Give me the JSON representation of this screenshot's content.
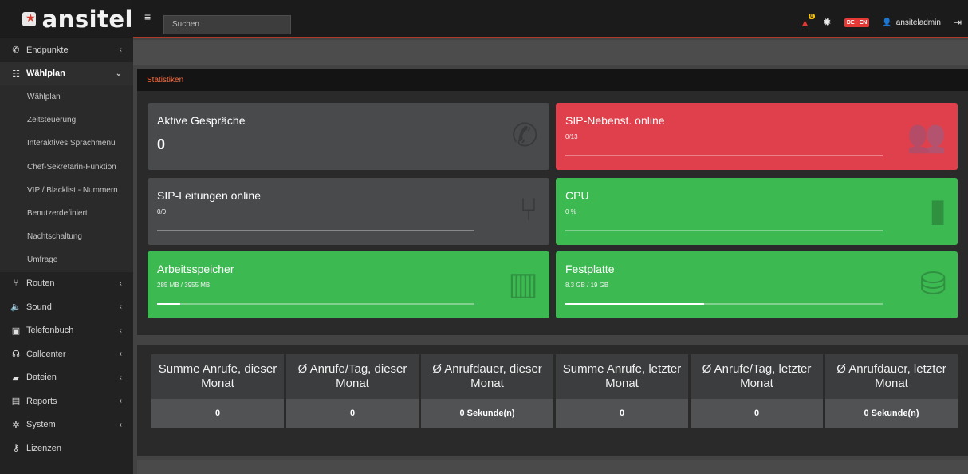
{
  "brand": {
    "name": "ansitel"
  },
  "header": {
    "search_placeholder": "Suchen",
    "alert_count": "0",
    "lang_de": "DE",
    "lang_en": "EN",
    "user": "ansiteladmin"
  },
  "sidebar": {
    "items": [
      {
        "label": "Endpunkte",
        "icon": "phone-icon"
      },
      {
        "label": "Wählplan",
        "icon": "sitemap-icon"
      },
      {
        "label": "Routen",
        "icon": "route-icon"
      },
      {
        "label": "Sound",
        "icon": "speaker-icon"
      },
      {
        "label": "Telefonbuch",
        "icon": "book-icon"
      },
      {
        "label": "Callcenter",
        "icon": "headset-icon"
      },
      {
        "label": "Dateien",
        "icon": "folder-icon"
      },
      {
        "label": "Reports",
        "icon": "chart-icon"
      },
      {
        "label": "System",
        "icon": "cogs-icon"
      },
      {
        "label": "Lizenzen",
        "icon": "key-icon"
      }
    ],
    "subitems": [
      "Wählplan",
      "Zeitsteuerung",
      "Interaktives Sprachmenü",
      "Chef-Sekretärin-Funktion",
      "VIP / Blacklist - Nummern",
      "Benutzerdefiniert",
      "Nachtschaltung",
      "Umfrage"
    ]
  },
  "stats": {
    "heading": "Statistiken",
    "cards": [
      {
        "title": "Aktive Gespräche",
        "value": "0",
        "color": "#484a4c"
      },
      {
        "title": "SIP-Nebenst. online",
        "value": "0/13",
        "color": "#e0404b",
        "progress": 0
      },
      {
        "title": "SIP-Leitungen online",
        "value": "0/0",
        "color": "#484a4c",
        "progress": 0
      },
      {
        "title": "CPU",
        "value": "0 %",
        "color": "#3db952",
        "progress": 0
      },
      {
        "title": "Arbeitsspeicher",
        "value": "285 MB / 3955 MB",
        "color": "#3db952",
        "progress": 0.072
      },
      {
        "title": "Festplatte",
        "value": "8.3 GB / 19 GB",
        "color": "#3db952",
        "progress": 0.437
      }
    ]
  },
  "calls": [
    {
      "label": "Summe Anrufe, dieser Monat",
      "value": "0"
    },
    {
      "label": "Ø Anrufe/Tag, dieser Monat",
      "value": "0"
    },
    {
      "label": "Ø Anrufdauer, dieser Monat",
      "value": "0 Sekunde(n)"
    },
    {
      "label": "Summe Anrufe, letzter Monat",
      "value": "0"
    },
    {
      "label": "Ø Anrufe/Tag, letzter Monat",
      "value": "0"
    },
    {
      "label": "Ø Anrufdauer, letzter Monat",
      "value": "0 Sekunde(n)"
    }
  ]
}
